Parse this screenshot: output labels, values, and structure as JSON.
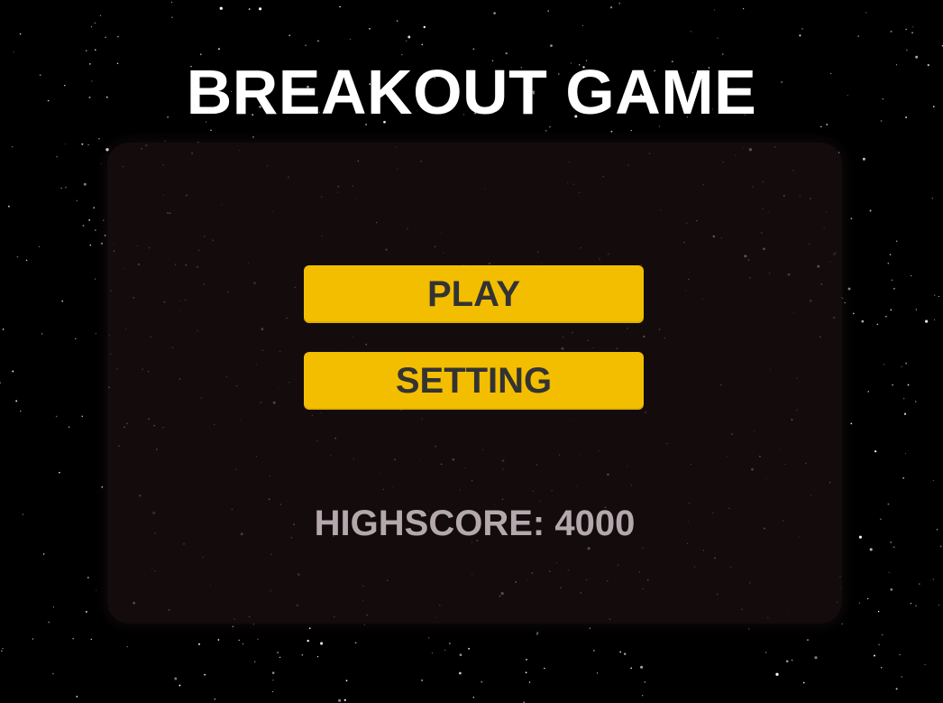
{
  "title": "BREAKOUT GAME",
  "menu": {
    "play_label": "PLAY",
    "setting_label": "SETTING"
  },
  "highscore": {
    "text": "HIGHSCORE: 4000"
  },
  "colors": {
    "background": "#000000",
    "title": "#ffffff",
    "panel": "#1a0f11",
    "button_fill": "#f3be00",
    "button_text": "#333333",
    "highscore_text": "#b4a8ad",
    "stars": "#ffffff"
  }
}
